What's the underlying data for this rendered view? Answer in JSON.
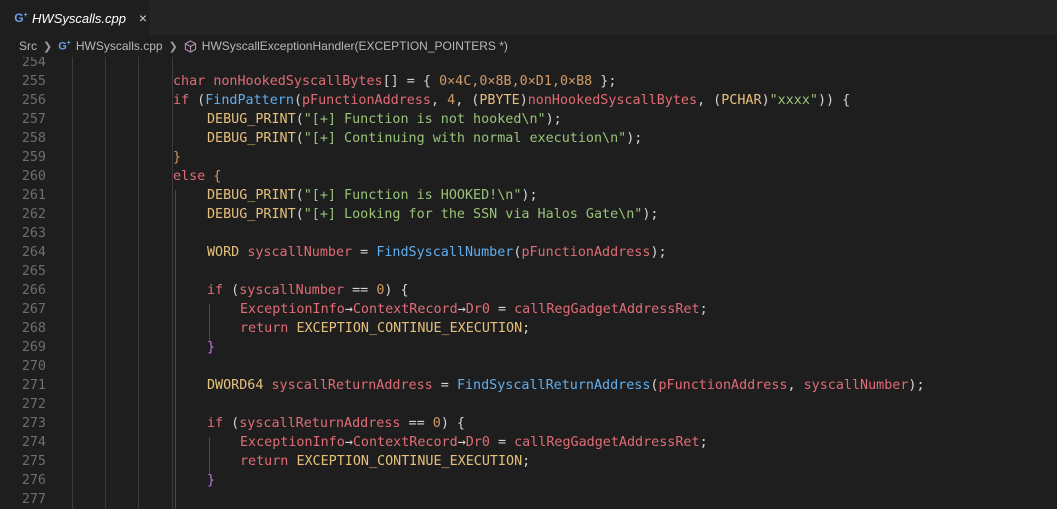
{
  "tab": {
    "title": "HWSyscalls.cpp",
    "close": "×",
    "icon": "cpp-file-icon"
  },
  "breadcrumb": {
    "folder": "Src",
    "file": "HWSyscalls.cpp",
    "symbol": "HWSyscallExceptionHandler(EXCEPTION_POINTERS *)"
  },
  "line_numbers": [
    "254",
    "255",
    "256",
    "257",
    "258",
    "259",
    "260",
    "261",
    "262",
    "263",
    "264",
    "265",
    "266",
    "267",
    "268",
    "269",
    "270",
    "271",
    "272",
    "273",
    "274",
    "275",
    "276",
    "277"
  ],
  "code": {
    "l255": {
      "kw": "char",
      "var": "nonHookedSyscallBytes",
      "rest1": "[] = { ",
      "nums": "0×4C,0×8B,0×D1,0×B8",
      "rest2": " };"
    },
    "l256": {
      "kw": "if",
      "open": " (",
      "fn": "FindPattern",
      "p1": "(",
      "a1": "pFunctionAddress",
      "p2": ", ",
      "num": "4",
      "p3": ", (",
      "t1": "PBYTE",
      "p4": ")",
      "a2": "nonHookedSyscallBytes",
      "p5": ", (",
      "t2": "PCHAR",
      "p6": ")",
      "s": "\"xxxx\"",
      "p7": ")) {"
    },
    "l257": {
      "m": "DEBUG_PRINT",
      "p1": "(",
      "s": "\"[+] Function is not hooked\\n\"",
      "p2": ");"
    },
    "l258": {
      "m": "DEBUG_PRINT",
      "p1": "(",
      "s": "\"[+] Continuing with normal execution\\n\"",
      "p2": ");"
    },
    "l259": {
      "p": "}"
    },
    "l260": {
      "kw": "else",
      "p": " {"
    },
    "l261": {
      "m": "DEBUG_PRINT",
      "p1": "(",
      "s": "\"[+] Function is HOOKED!\\n\"",
      "p2": ");"
    },
    "l262": {
      "m": "DEBUG_PRINT",
      "p1": "(",
      "s": "\"[+] Looking for the SSN via Halos Gate\\n\"",
      "p2": ");"
    },
    "l264": {
      "t": "WORD",
      "v": "syscallNumber",
      "p1": " = ",
      "fn": "FindSyscallNumber",
      "p2": "(",
      "a": "pFunctionAddress",
      "p3": ");"
    },
    "l266": {
      "kw": "if",
      "p1": " (",
      "v": "syscallNumber",
      "op": " == ",
      "n": "0",
      "p2": ") {"
    },
    "l267": {
      "a": "ExceptionInfo",
      "arr1": "→",
      "b": "ContextRecord",
      "arr2": "→",
      "c": "Dr0",
      "p1": " = ",
      "d": "callRegGadgetAddressRet",
      "p2": ";"
    },
    "l268": {
      "kw": "return",
      "c": "EXCEPTION_CONTINUE_EXECUTION",
      "p": ";"
    },
    "l269": {
      "p": "}"
    },
    "l271": {
      "t": "DWORD64",
      "v": "syscallReturnAddress",
      "p1": " = ",
      "fn": "FindSyscallReturnAddress",
      "p2": "(",
      "a": "pFunctionAddress",
      "p3": ", ",
      "b": "syscallNumber",
      "p4": ");"
    },
    "l273": {
      "kw": "if",
      "p1": " (",
      "v": "syscallReturnAddress",
      "op": " == ",
      "n": "0",
      "p2": ") {"
    },
    "l274": {
      "a": "ExceptionInfo",
      "arr1": "→",
      "b": "ContextRecord",
      "arr2": "→",
      "c": "Dr0",
      "p1": " = ",
      "d": "callRegGadgetAddressRet",
      "p2": ";"
    },
    "l275": {
      "kw": "return",
      "c": "EXCEPTION_CONTINUE_EXECUTION",
      "p": ";"
    },
    "l276": {
      "p": "}"
    }
  },
  "colors": {
    "background": "#1e1e1e",
    "keyword": "#e06c75",
    "type": "#e5c07b",
    "function": "#61afef",
    "string": "#98c379",
    "number": "#d19a66"
  }
}
